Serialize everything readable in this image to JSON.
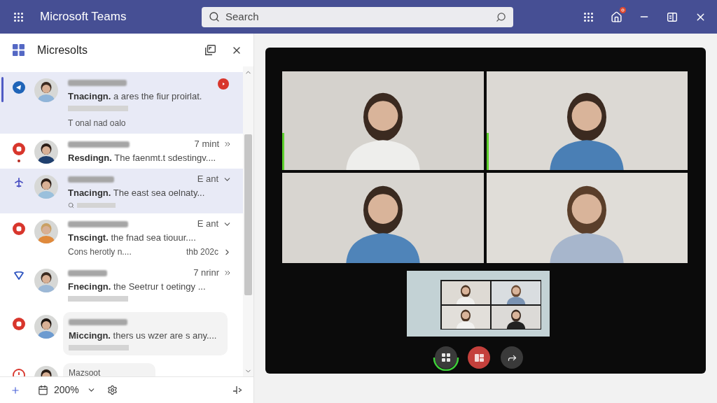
{
  "title_bar": {
    "app_title": "Microsoft Teams",
    "search": {
      "placeholder": "Search"
    },
    "notification_badge": true
  },
  "sidebar": {
    "title": "Micresolts",
    "chats": [
      {
        "status": {
          "kind": "send"
        },
        "selected": true,
        "highlighted": true,
        "unread": true,
        "presence_dot": false,
        "bubble": false,
        "preview": "**Tnacingn.** a ares the fiur proirlat.",
        "attachment": {
          "kind": "bar"
        },
        "footnote": "T onal nad oalo"
      },
      {
        "status": {
          "kind": "stop"
        },
        "selected": false,
        "highlighted": false,
        "unread": false,
        "presence_dot": true,
        "bubble": false,
        "time": "7 mint",
        "time_icon": {
          "kind": "double-chevron"
        },
        "preview": "**Resdingn.** The faenmt.t sdestingv...."
      },
      {
        "status": {
          "kind": "plane"
        },
        "selected": false,
        "highlighted": true,
        "unread": false,
        "presence_dot": false,
        "bubble": false,
        "time": "E ant",
        "time_icon": {
          "kind": "chevron-down"
        },
        "preview": "**Tnacingn.** The east sea oelnaty...",
        "attachment": {
          "kind": "search-bar"
        }
      },
      {
        "status": {
          "kind": "stop"
        },
        "selected": false,
        "highlighted": false,
        "unread": false,
        "presence_dot": false,
        "bubble": false,
        "time": "E ant",
        "time_icon": {
          "kind": "chevron-down"
        },
        "preview": "**Tnscingt.** the fnad sea tiouur....",
        "sub": "Cons herotly n....",
        "sub_time": "thb 202c"
      },
      {
        "status": {
          "kind": "triangle"
        },
        "selected": false,
        "highlighted": false,
        "unread": false,
        "presence_dot": false,
        "bubble": false,
        "time": "7 nrinr",
        "time_icon": {
          "kind": "double-chevron"
        },
        "preview": "**Fnecingn.** the Seetrur t oetingy ...",
        "attachment": {
          "kind": "bar"
        }
      },
      {
        "status": {
          "kind": "stop"
        },
        "selected": false,
        "highlighted": false,
        "unread": false,
        "presence_dot": false,
        "bubble": true,
        "preview": "**Miccingn.** thers us wzer are s any....",
        "attachment": {
          "kind": "bar"
        }
      },
      {
        "status": {
          "kind": "ring"
        },
        "selected": false,
        "highlighted": false,
        "unread": false,
        "presence_dot": false,
        "bubble": true,
        "name": "Mazsoot"
      }
    ],
    "footer": {
      "zoom": "200%"
    }
  },
  "meeting": {
    "tiles": [
      {
        "speaking": true
      },
      {
        "speaking": true
      },
      {
        "speaking": false
      },
      {
        "speaking": false
      }
    ],
    "controls": [
      {
        "kind": "layout",
        "progress_ring": true
      },
      {
        "kind": "stop-share",
        "progress_ring": false
      },
      {
        "kind": "forward",
        "progress_ring": false
      }
    ]
  }
}
